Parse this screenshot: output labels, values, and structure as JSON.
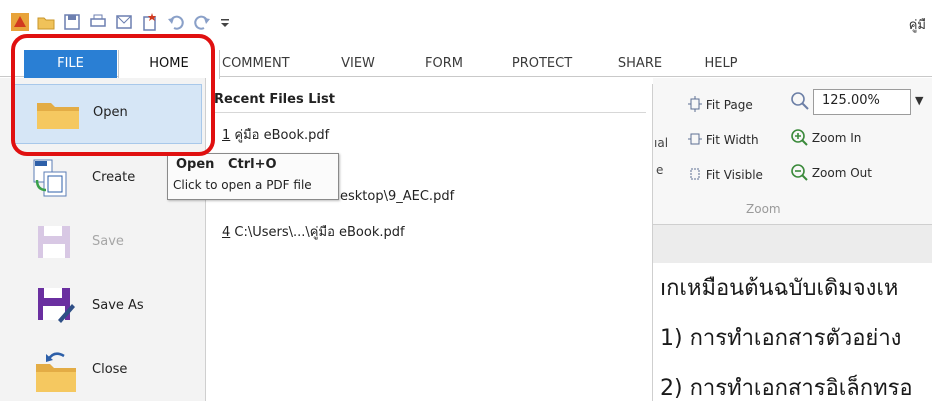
{
  "window": {
    "title_fragment": "คู่มื"
  },
  "tabs": [
    {
      "label": "FILE"
    },
    {
      "label": "HOME"
    },
    {
      "label": "COMMENT"
    },
    {
      "label": "VIEW"
    },
    {
      "label": "FORM"
    },
    {
      "label": "PROTECT"
    },
    {
      "label": "SHARE"
    },
    {
      "label": "HELP"
    }
  ],
  "file_menu": {
    "items": [
      {
        "label": "Open",
        "icon": "folder-icon",
        "state": "selected"
      },
      {
        "label": "Create",
        "icon": "create-pdf-icon"
      },
      {
        "label": "Save",
        "icon": "save-icon",
        "state": "disabled"
      },
      {
        "label": "Save As",
        "icon": "save-as-icon"
      },
      {
        "label": "Close",
        "icon": "close-folder-icon"
      }
    ]
  },
  "recent": {
    "heading": "Recent Files List",
    "files": [
      {
        "num": "1",
        "name": " คู่มือ eBook.pdf"
      },
      {
        "num": "",
        "name": "f"
      },
      {
        "num": "",
        "name": "esktop\\9_AEC.pdf"
      },
      {
        "num": "4",
        "name": " C:\\Users\\...\\คู่มือ eBook.pdf"
      }
    ]
  },
  "tooltip": {
    "title": "Open   Ctrl+O",
    "description": "Click to open a PDF file"
  },
  "ribbon": {
    "fit_page": "Fit Page",
    "fit_width": "Fit Width",
    "fit_visible": "Fit Visible",
    "zoom_value": "125.00%",
    "zoom_in": "Zoom In",
    "zoom_out": "Zoom Out",
    "group_label": "Zoom",
    "partial_labels": [
      "ıal",
      "e"
    ]
  },
  "document": {
    "lines": [
      "ıกเหมือนต้นฉบับเดิมจงเห",
      "1) การทำเอกสารตัวอย่าง",
      "2) การทำเอกสารอิเล็กทรอ"
    ]
  },
  "colors": {
    "file_tab": "#2a7fd4",
    "highlight": "#e01010",
    "selected_item": "#d6e6f6"
  }
}
